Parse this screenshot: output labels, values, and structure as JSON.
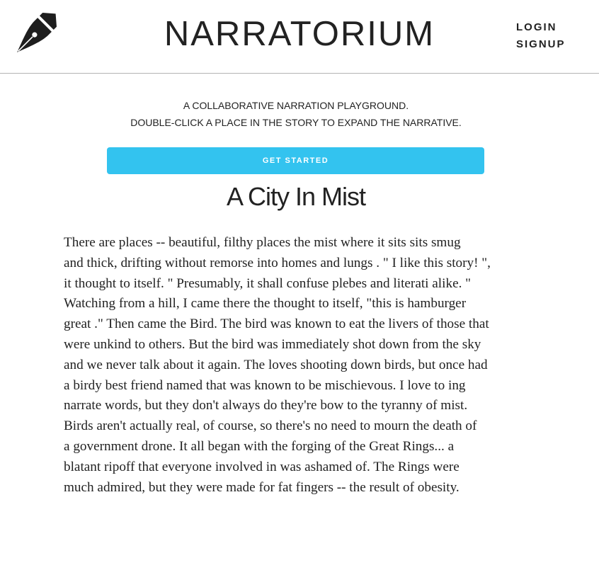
{
  "header": {
    "brand": "NARRATORIUM",
    "login_label": "LOGIN",
    "signup_label": "SIGNUP",
    "logo_icon": "fountain-pen-icon"
  },
  "intro": {
    "line1": "A COLLABORATIVE NARRATION PLAYGROUND.",
    "line2": "DOUBLE-CLICK A PLACE IN THE STORY TO EXPAND THE NARRATIVE."
  },
  "cta": {
    "label": "GET STARTED",
    "color": "#33c3ef"
  },
  "story": {
    "title": "A City In Mist",
    "lines": [
      "There are places -- beautiful, filthy places the mist where it sits sits smug",
      "and thick, drifting without remorse into homes and lungs . \" I like this story! \",",
      "it thought to itself. \" Presumably, it shall confuse plebes and literati alike. \"",
      "Watching from a hill, I came there the thought to itself, \"this is hamburger",
      "great .\" Then came the Bird. The bird was known to eat the livers of those that",
      "were unkind to others. But the bird was immediately shot down from the sky",
      "and we never talk about it again. The loves shooting down birds, but once had",
      "a birdy best friend named that was known to be mischievous. I love to ing",
      "narrate words, but they don't always do they're bow to the tyranny of mist.",
      "Birds aren't actually real, of course, so there's no need to mourn the death of",
      "a government drone. It all began with the forging of the Great Rings... a",
      "blatant ripoff that everyone involved in was ashamed of. The Rings were",
      "much admired, but they were made for fat fingers -- the result of obesity."
    ]
  }
}
